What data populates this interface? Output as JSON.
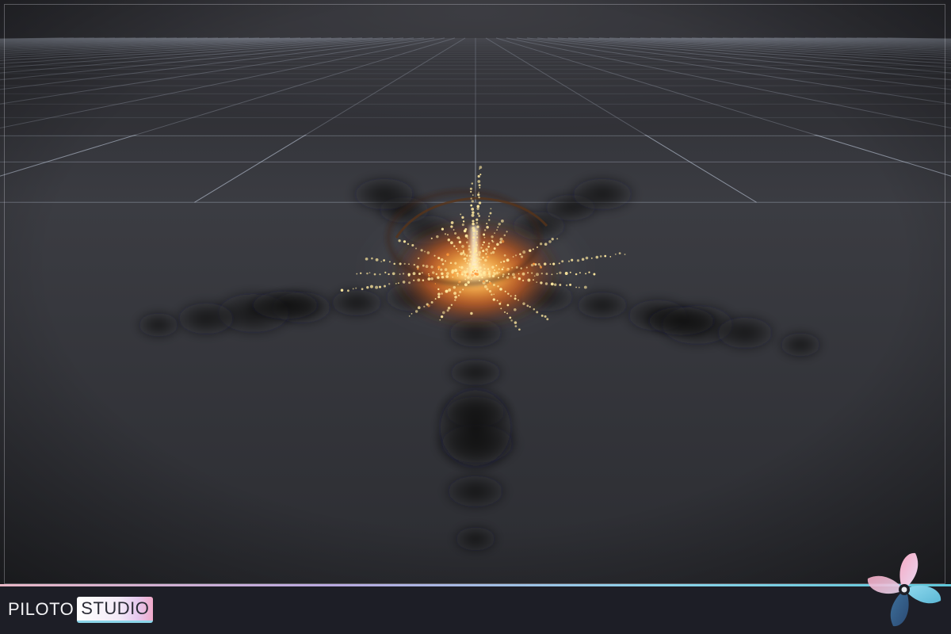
{
  "viewport": {
    "label": "particle-effect-preview",
    "floor": "grid",
    "effect": "fire-burst-with-sparks-and-smoke"
  },
  "branding": {
    "brand_left": "PILOTO",
    "brand_right": "STUDIO",
    "logo_icon": "fan-icon"
  },
  "colors": {
    "bottom_bar": "#1d1e26",
    "grid_line": "#c9d4e6",
    "fire_core": "#ffb347",
    "spark": "#ffe9a0",
    "smoke": "#101012"
  }
}
